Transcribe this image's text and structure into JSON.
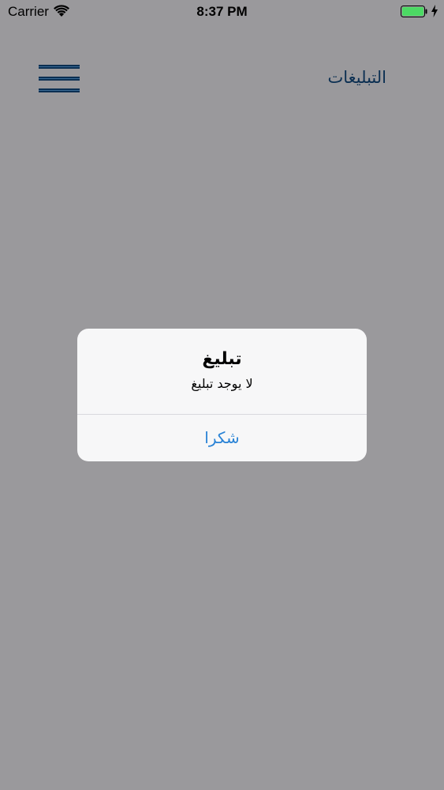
{
  "status_bar": {
    "carrier": "Carrier",
    "time": "8:37 PM",
    "battery_color": "#4cd964"
  },
  "nav": {
    "title": "التبليغات",
    "menu_icon": "hamburger-menu-icon",
    "title_color": "#0b2f52"
  },
  "alert": {
    "title": "تبليغ",
    "message": "لا يوجد تبليغ",
    "button_label": "شكرا",
    "button_color": "#2a83d6"
  },
  "colors": {
    "overlay_background": "#9a999c",
    "alert_background": "#f7f7f8"
  }
}
